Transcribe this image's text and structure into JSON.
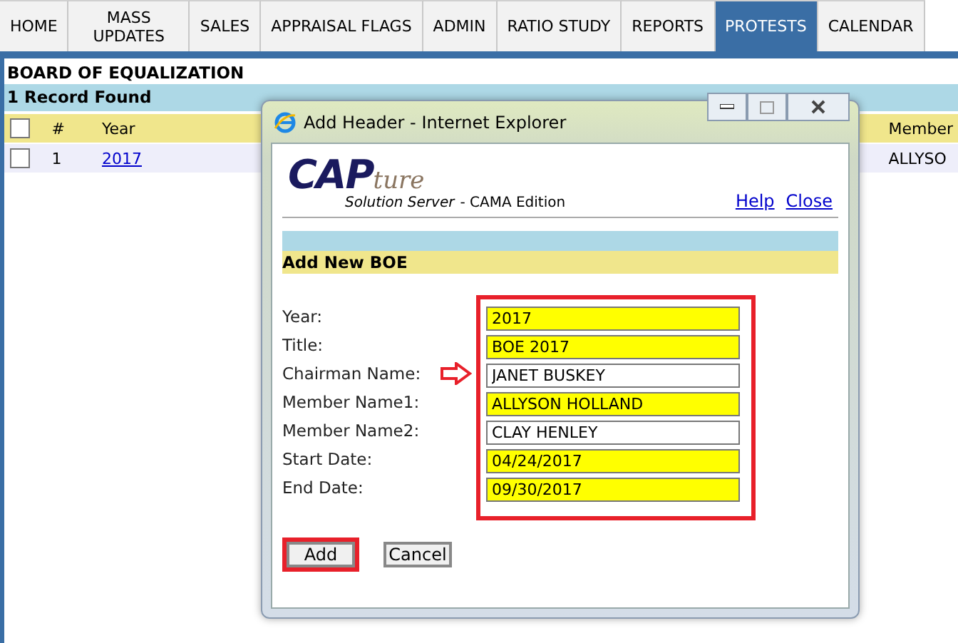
{
  "nav_tabs": [
    {
      "label": "HOME",
      "selected": false
    },
    {
      "label": "MASS UPDATES",
      "selected": false
    },
    {
      "label": "SALES",
      "selected": false
    },
    {
      "label": "APPRAISAL FLAGS",
      "selected": false
    },
    {
      "label": "ADMIN",
      "selected": false
    },
    {
      "label": "RATIO STUDY",
      "selected": false
    },
    {
      "label": "REPORTS",
      "selected": false
    },
    {
      "label": "PROTESTS",
      "selected": true
    },
    {
      "label": "CALENDAR",
      "selected": false
    }
  ],
  "page_title": "BOARD OF EQUALIZATION",
  "record_count": "1 Record Found",
  "table": {
    "columns": [
      {
        "label": "#"
      },
      {
        "label": "Year"
      },
      {
        "label": "Member"
      }
    ],
    "rows": [
      {
        "checked": false,
        "number": "1",
        "year": "2017",
        "member": "ALLYSO"
      }
    ],
    "header_checked": false
  },
  "dialog": {
    "title": "Add Header - Internet Explorer",
    "logo_main": "CAP",
    "logo_script": "ture",
    "logo_sub": "Solution Server",
    "logo_edition": "- CAMA Edition",
    "links": [
      "Help",
      "Close"
    ],
    "section_title": "Add New BOE",
    "fields": [
      {
        "label": "Year:",
        "value": "2017",
        "highlighted": true,
        "pointed": false
      },
      {
        "label": "Title:",
        "value": "BOE 2017",
        "highlighted": true,
        "pointed": false
      },
      {
        "label": "Chairman Name:",
        "value": "JANET BUSKEY",
        "highlighted": false,
        "pointed": true
      },
      {
        "label": "Member Name1:",
        "value": "ALLYSON HOLLAND",
        "highlighted": true,
        "pointed": false
      },
      {
        "label": "Member Name2:",
        "value": "CLAY HENLEY",
        "highlighted": false,
        "pointed": false
      },
      {
        "label": "Start Date:",
        "value": "04/24/2017",
        "highlighted": true,
        "pointed": false
      },
      {
        "label": "End Date:",
        "value": "09/30/2017",
        "highlighted": true,
        "pointed": false
      }
    ],
    "buttons": [
      {
        "label": "Add",
        "annotated": true
      },
      {
        "label": "Cancel",
        "annotated": false
      }
    ]
  }
}
